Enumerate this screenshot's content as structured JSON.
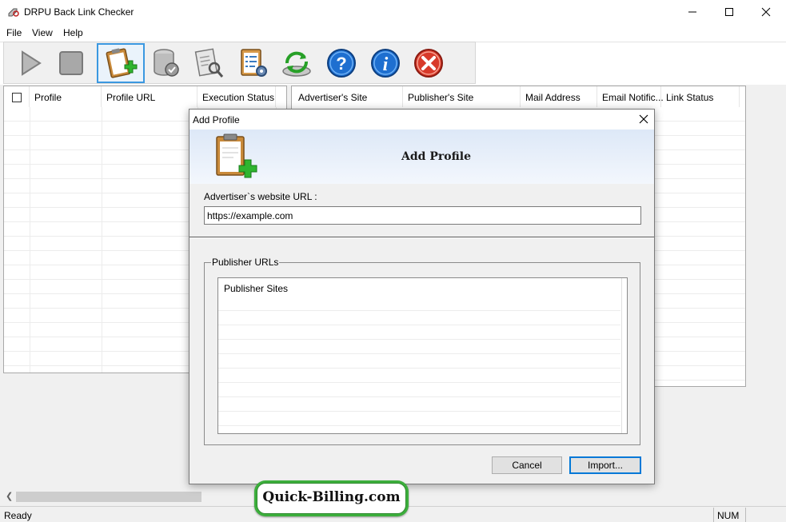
{
  "window": {
    "title": "DRPU Back Link Checker"
  },
  "menu": [
    {
      "label": "File"
    },
    {
      "label": "View"
    },
    {
      "label": "Help"
    }
  ],
  "toolbar": {
    "buttons": [
      {
        "icon": "play-icon",
        "active": false
      },
      {
        "icon": "stop-icon",
        "active": false
      },
      {
        "icon": "add-profile-icon",
        "active": true
      },
      {
        "icon": "database-icon",
        "active": false
      },
      {
        "icon": "report-icon",
        "active": false
      },
      {
        "icon": "settings-checklist-icon",
        "active": false
      },
      {
        "icon": "refresh-icon",
        "active": false
      },
      {
        "icon": "help-icon",
        "active": false
      },
      {
        "icon": "info-icon",
        "active": false
      },
      {
        "icon": "exit-icon",
        "active": false
      }
    ]
  },
  "left_list": {
    "columns": [
      {
        "label": "Profile"
      },
      {
        "label": "Profile URL"
      },
      {
        "label": "Execution Status"
      }
    ]
  },
  "right_list": {
    "columns": [
      {
        "label": "Advertiser's Site"
      },
      {
        "label": "Publisher's Site"
      },
      {
        "label": "Mail Address"
      },
      {
        "label": "Email Notific..."
      },
      {
        "label": "Link Status"
      }
    ]
  },
  "statusbar": {
    "status": "Ready",
    "num": "NUM"
  },
  "dialog": {
    "title": "Add Profile",
    "heading": "Add Profile",
    "url_label": "Advertiser`s website URL :",
    "url_value": "https://example.com",
    "publisher_group_label": "Publisher URLs",
    "publisher_list_header": "Publisher Sites",
    "cancel_label": "Cancel",
    "import_label": "Import..."
  },
  "watermark": {
    "text": "Quick-Billing.com"
  },
  "colors": {
    "accent": "#0078d7",
    "toolbar_active": "#3b98e0",
    "watermark_green": "#3cae3c"
  }
}
